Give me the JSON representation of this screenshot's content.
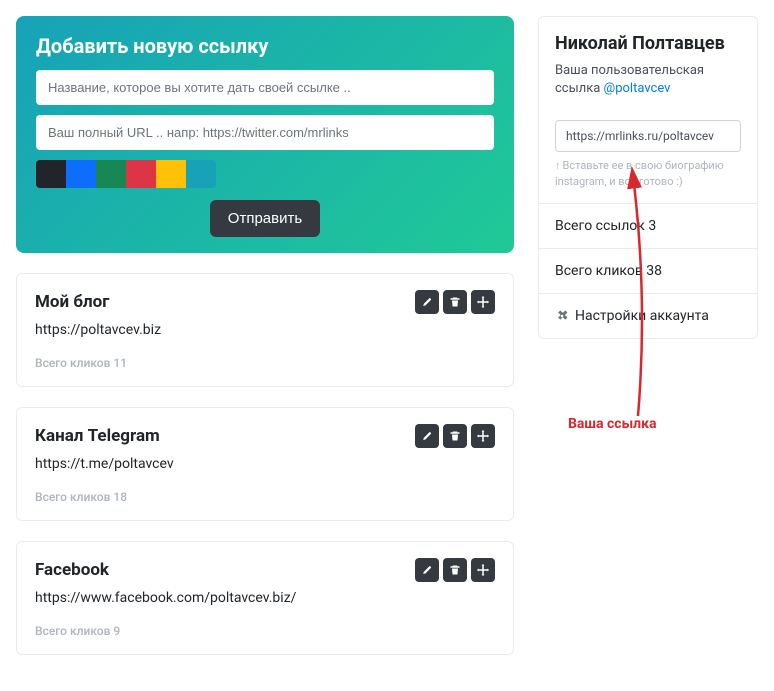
{
  "add_form": {
    "title": "Добавить новую ссылку",
    "name_placeholder": "Название, которое вы хотите дать своей ссылке ..",
    "url_placeholder": "Ваш полный URL .. напр: https://twitter.com/mrlinks",
    "submit": "Отправить",
    "colors": [
      "#212529",
      "#0d6efd",
      "#198754",
      "#dc3545",
      "#ffc107",
      "#17a2b8"
    ]
  },
  "links": [
    {
      "title": "Мой блог",
      "url": "https://poltavcev.biz",
      "clicks_label": "Всего кликов 11"
    },
    {
      "title": "Канал Telegram",
      "url": "https://t.me/poltavcev",
      "clicks_label": "Всего кликов 18"
    },
    {
      "title": "Facebook",
      "url": "https://www.facebook.com/poltavcev.biz/",
      "clicks_label": "Всего кликов 9"
    }
  ],
  "profile": {
    "name": "Николай Полтавцев",
    "sub_prefix": "Ваша пользовательская ссылка ",
    "handle": "@poltavcev",
    "share_url": "https://mrlinks.ru/poltavcev",
    "hint": "Вставьте ее в свою биографию instagram, и все готово :)",
    "total_links": "Всего ссылок 3",
    "total_clicks": "Всего кликов 38",
    "settings": "Настройки аккаунта"
  },
  "annotation": {
    "label": "Ваша ссылка"
  }
}
